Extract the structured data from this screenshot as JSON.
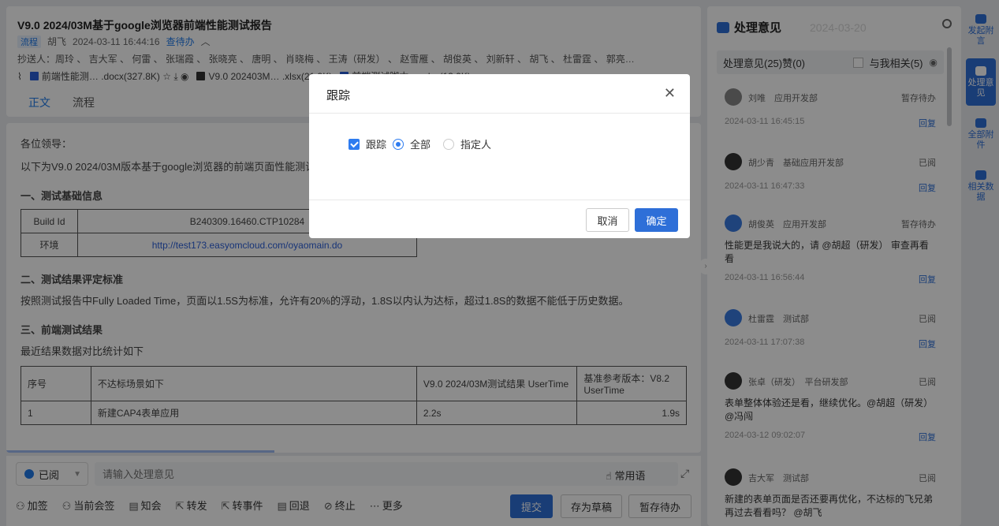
{
  "doc": {
    "title": "V9.0 2024/03M基于google浏览器前端性能测试报告",
    "tag": "流程",
    "author": "胡飞",
    "datetime": "2024-03-11 16:44:16",
    "status": "查待办",
    "recipients": "抄送人：周玲 、 吉大军 、 何雷 、 张瑞霞 、 张晓亮 、 唐明 、 肖晓梅 、 王涛（研发） 、 赵雪雁 、 胡俊英 、 刘新轩 、 胡飞 、 杜雷霆 、 郭亮…",
    "attachments": [
      {
        "name": "前端性能测… .docx(327.8K)"
      },
      {
        "name": "V9.0 202403M… .xlsx(21.9K)"
      },
      {
        "name": "前端测试脚本… .xlsx(13.9K)"
      }
    ],
    "tabs": [
      "正文",
      "流程"
    ],
    "body": {
      "greeting": "各位领导：",
      "intro": "以下为V9.0 2024/03M版本基于google浏览器的前端页面性能测试报告，请查阅。",
      "section1": "一、测试基础信息",
      "table1": [
        {
          "label": "Build Id",
          "value": "B240309.16460.CTP10284"
        },
        {
          "label": "环境",
          "value": "http://test173.easyomcloud.com/oyaomain.do"
        }
      ],
      "section2": "二、测试结果评定标准",
      "criteria": "按照测试报告中Fully Loaded Time，页面以1.5S为标准，允许有20%的浮动，1.8S以内认为达标，超过1.8S的数据不能低于历史数据。",
      "section3": "三、前端测试结果",
      "result_intro": "最近结果数据对比统计如下",
      "table2_headers": [
        "序号",
        "不达标场景如下",
        "V9.0 2024/03M测试结果 UserTime",
        "基准参考版本：V8.2 UserTime"
      ],
      "table2_row": [
        "1",
        "新建CAP4表单应用",
        "2.2s",
        "1.9s"
      ]
    }
  },
  "opinion": {
    "read_status": "已阅",
    "placeholder": "请输入处理意见",
    "common_phrase": "常用语",
    "actions": [
      "加签",
      "当前会签",
      "知会",
      "转发",
      "转事件",
      "回退",
      "终止",
      "更多"
    ],
    "submit": "提交",
    "draft": "存为草稿",
    "save_pending": "暂存待办"
  },
  "comments": {
    "title": "处理意见",
    "watermark": "2024-03-20",
    "summary": "处理意见(25)赞(0)",
    "related": "与我相关(5)",
    "items": [
      {
        "name": "刘唯",
        "dept": "应用开发部",
        "status": "暂存待办",
        "text": "",
        "date": "2024-03-11 16:45:15",
        "reply": "回复"
      },
      {
        "name": "胡少青",
        "dept": "基础应用开发部",
        "status": "已阅",
        "text": "",
        "date": "2024-03-11 16:47:33",
        "reply": "回复"
      },
      {
        "name": "胡俊英",
        "dept": "应用开发部",
        "status": "暂存待办",
        "text": "性能更是我说大的，请 @胡超（研发） 审查再看看",
        "date": "2024-03-11 16:56:44",
        "reply": "回复"
      },
      {
        "name": "杜雷霆",
        "dept": "测试部",
        "status": "已阅",
        "text": "",
        "date": "2024-03-11 17:07:38",
        "reply": "回复"
      },
      {
        "name": "张卓（研发）",
        "dept": "平台研发部",
        "status": "已阅",
        "text": "表单整体体验还是看，继续优化。@胡超（研发）@冯闯",
        "date": "2024-03-12 09:02:07",
        "reply": "回复"
      },
      {
        "name": "吉大军",
        "dept": "测试部",
        "status": "已阅",
        "text": "新建的表单页面是否还要再优化，不达标的飞兄弟再过去看看吗？ @胡飞",
        "date": "",
        "reply": ""
      }
    ]
  },
  "rail": [
    {
      "label": "发起附言"
    },
    {
      "label": "处理意见"
    },
    {
      "label": "全部附件"
    },
    {
      "label": "相关数据"
    }
  ],
  "dialog": {
    "title": "跟踪",
    "checkbox_label": "跟踪",
    "option_all": "全部",
    "option_specified": "指定人",
    "cancel": "取消",
    "ok": "确定"
  }
}
